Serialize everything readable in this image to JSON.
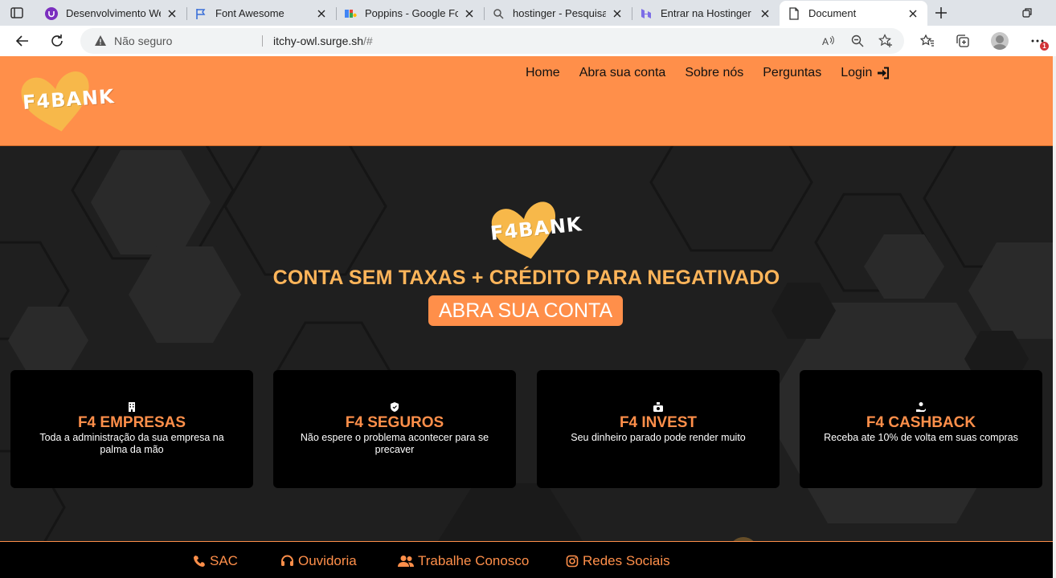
{
  "browser": {
    "tabs": [
      {
        "title": "Desenvolvimento Web",
        "icon": "udemy-icon"
      },
      {
        "title": "Font Awesome",
        "icon": "flag-icon"
      },
      {
        "title": "Poppins - Google Fonts",
        "icon": "google-fonts-icon"
      },
      {
        "title": "hostinger - Pesquisar",
        "icon": "search-icon"
      },
      {
        "title": "Entrar na Hostinger",
        "icon": "hostinger-icon"
      },
      {
        "title": "Document",
        "icon": "document-icon",
        "active": true
      }
    ],
    "security_label": "Não seguro",
    "url_host": "itchy-owl.surge.sh",
    "url_path": "/#",
    "notification_count": "1"
  },
  "site": {
    "logo_text": "F4BANK",
    "nav": [
      {
        "label": "Home"
      },
      {
        "label": "Abra sua conta"
      },
      {
        "label": "Sobre nós"
      },
      {
        "label": "Perguntas"
      },
      {
        "label": "Login"
      }
    ],
    "hero": {
      "tagline": "CONTA SEM TAXAS + CRÉDITO PARA NEGATIVADO",
      "cta_label": "ABRA SUA CONTA"
    },
    "cards": [
      {
        "title": "F4 EMPRESAS",
        "text": "Toda a administração da sua empresa na palma da mão",
        "icon": "building-icon"
      },
      {
        "title": "F4 SEGUROS",
        "text": "Não espere o problema acontecer para se precaver",
        "icon": "shield-icon"
      },
      {
        "title": "F4 INVEST",
        "text": "Seu dinheiro parado pode render muito",
        "icon": "piggy-bank-icon"
      },
      {
        "title": "F4 CASHBACK",
        "text": "Receba ate 10% de volta em suas compras",
        "icon": "hand-coin-icon"
      }
    ],
    "footer": [
      {
        "label": "SAC",
        "icon": "phone-icon"
      },
      {
        "label": "Ouvidoria",
        "icon": "headset-icon"
      },
      {
        "label": "Trabalhe Conosco",
        "icon": "users-icon"
      },
      {
        "label": "Redes Sociais",
        "icon": "instagram-icon"
      }
    ]
  },
  "colors": {
    "brand_orange": "#ff8f4a",
    "tagline_yellow": "#ffb55a",
    "heart_yellow": "#f7b84a",
    "hero_bg": "#1f1f1f"
  }
}
